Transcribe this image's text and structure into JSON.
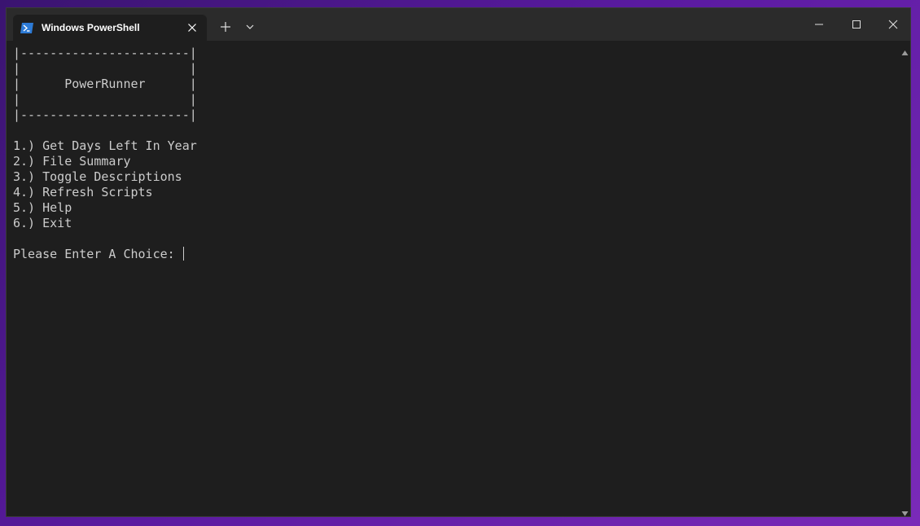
{
  "window": {
    "tab_title": "Windows PowerShell",
    "tab_icon": "powershell-icon"
  },
  "terminal": {
    "lines": [
      "|-----------------------|",
      "|                       |",
      "|      PowerRunner      |",
      "|                       |",
      "|-----------------------|",
      "",
      "1.) Get Days Left In Year",
      "2.) File Summary",
      "3.) Toggle Descriptions",
      "4.) Refresh Scripts",
      "5.) Help",
      "6.) Exit",
      "",
      "Please Enter A Choice: "
    ]
  },
  "colors": {
    "terminal_bg": "#1e1e1e",
    "titlebar_bg": "#2b2b2b",
    "text": "#cccccc",
    "desktop_accent": "#5a1aa0"
  }
}
